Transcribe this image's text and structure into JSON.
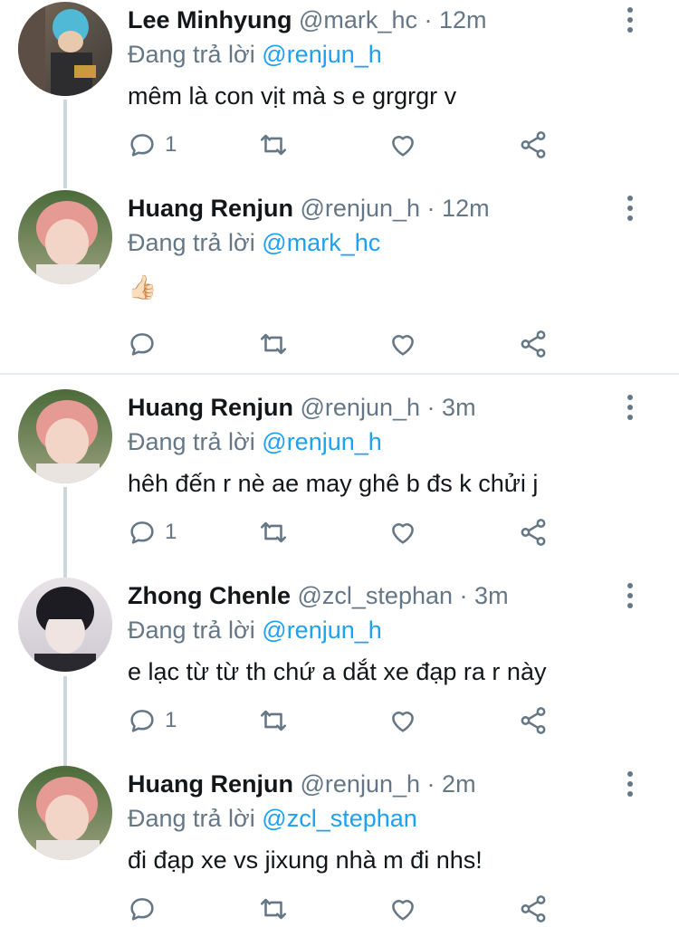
{
  "reply_prefix": "Đang trả lời",
  "colors": {
    "accent": "#1da1f2",
    "secondary": "#657786",
    "text": "#14171a",
    "thread_line": "#ccd6dd"
  },
  "icons": [
    "reply-icon",
    "retweet-icon",
    "like-icon",
    "share-icon",
    "more-options-icon",
    "thumbs-up-icon"
  ],
  "tweets": [
    {
      "name": "Lee Minhyung",
      "handle": "@mark_hc",
      "dot": "·",
      "time": "12m",
      "reply_to": "@renjun_h",
      "text": "mêm là con vịt mà s e grgrgr v",
      "reply_count": "1"
    },
    {
      "name": "Huang Renjun",
      "handle": "@renjun_h",
      "dot": "·",
      "time": "12m",
      "reply_to": "@mark_hc",
      "text": "👍🏻",
      "reply_count": ""
    },
    {
      "name": "Huang Renjun",
      "handle": "@renjun_h",
      "dot": "·",
      "time": "3m",
      "reply_to": "@renjun_h",
      "text": "hêh đến r nè ae may ghê b đs k chửi j",
      "reply_count": "1"
    },
    {
      "name": "Zhong Chenle",
      "handle": "@zcl_stephan",
      "dot": "·",
      "time": "3m",
      "reply_to": "@renjun_h",
      "text": "e lạc từ từ th chứ a dắt xe đạp ra r này",
      "reply_count": "1"
    },
    {
      "name": "Huang Renjun",
      "handle": "@renjun_h",
      "dot": "·",
      "time": "2m",
      "reply_to": "@zcl_stephan",
      "text": "đi đạp xe vs jixung nhà m đi nhs!",
      "reply_count": ""
    }
  ]
}
